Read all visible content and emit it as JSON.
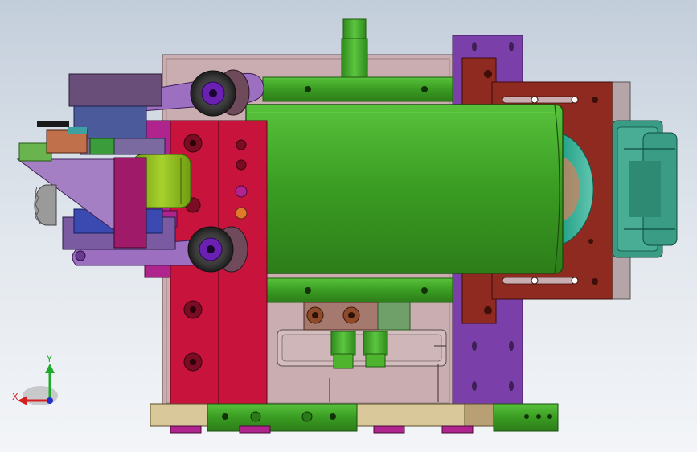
{
  "view": {
    "background_top": "#c3cedb",
    "background_bottom": "#f3f5f8"
  },
  "triad": {
    "x_label": "X",
    "y_label": "Y",
    "x_color": "#d42020",
    "y_color": "#1faa2a",
    "z_color": "#2030c8"
  },
  "palette": {
    "frame": "#c9adb0",
    "green": "#3fa52a",
    "crimson": "#c8143c",
    "purple": "#7a3fa8",
    "brown": "#8e2a1f",
    "teal": "#3ea08a",
    "base": "#d8c89a",
    "magenta": "#b0248e"
  }
}
